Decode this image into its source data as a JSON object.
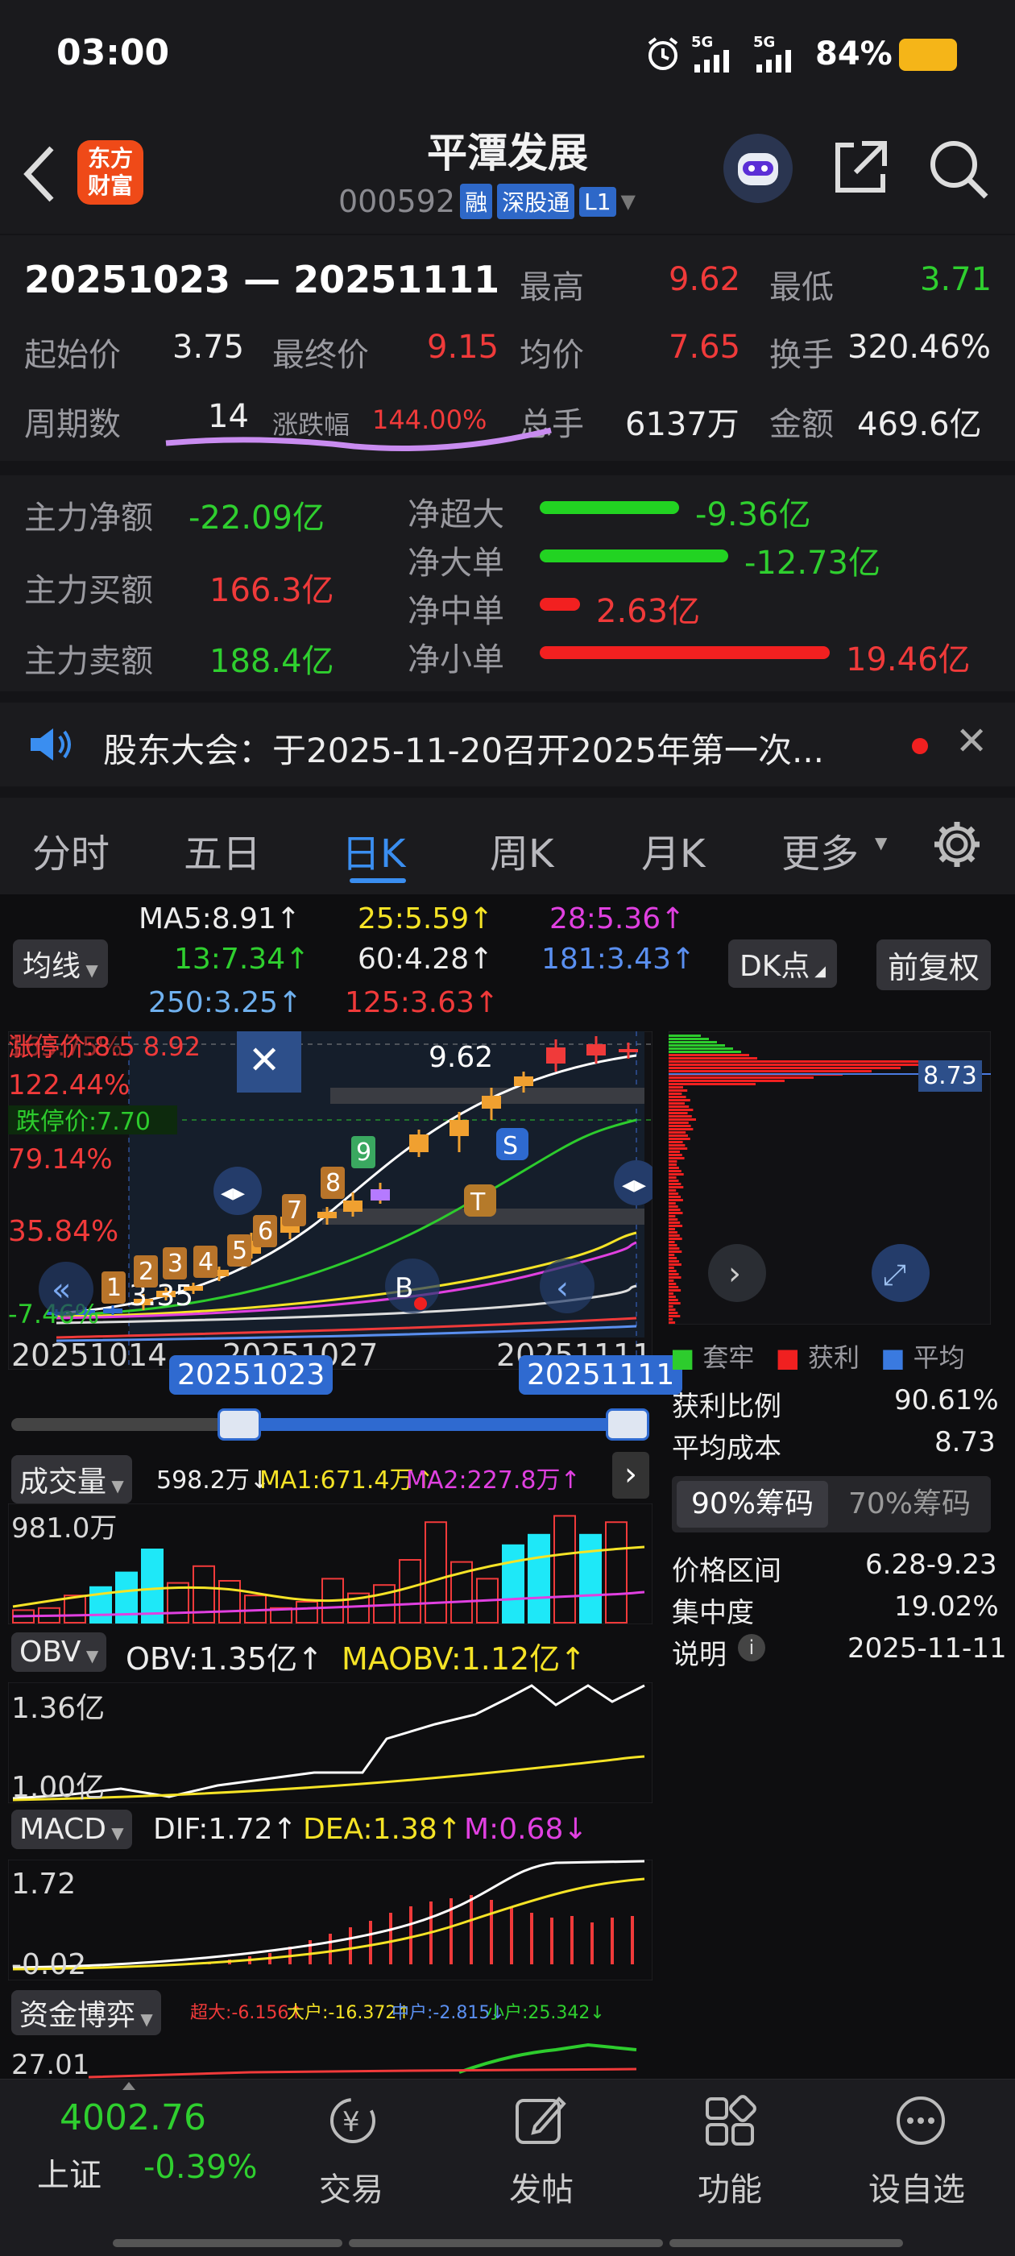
{
  "status_bar": {
    "time": "03:00",
    "signal1": "5G",
    "signal2": "5G",
    "battery": "84%"
  },
  "header": {
    "brand_line1": "东方",
    "brand_line2": "财富",
    "title": "平潭发展",
    "code": "000592",
    "badge_margin": "融",
    "badge_connect": "深股通",
    "badge_level": "L1"
  },
  "range": {
    "dates": "20251023 — 20251111",
    "high_label": "最高",
    "high": "9.62",
    "low_label": "最低",
    "low": "3.71",
    "start_label": "起始价",
    "start": "3.75",
    "end_label": "最终价",
    "end": "9.15",
    "avg_label": "均价",
    "avg": "7.65",
    "turnover_label": "换手",
    "turnover": "320.46%",
    "periods_label": "周期数",
    "periods": "14",
    "change_label": "涨跌幅",
    "change": "144.00%",
    "volume_label": "总手",
    "volume": "6137万",
    "amount_label": "金额",
    "amount": "469.6亿"
  },
  "fund_flow": {
    "net_label": "主力净额",
    "net": "-22.09亿",
    "buy_label": "主力买额",
    "buy": "166.3亿",
    "sell_label": "主力卖额",
    "sell": "188.4亿",
    "bars": [
      {
        "label": "净超大",
        "value": "-9.36亿",
        "color": "#22d322",
        "ratio": 0.48
      },
      {
        "label": "净大单",
        "value": "-12.73亿",
        "color": "#22d322",
        "ratio": 0.65
      },
      {
        "label": "净中单",
        "value": "2.63亿",
        "color": "#f22020",
        "ratio": 0.14
      },
      {
        "label": "净小单",
        "value": "19.46亿",
        "color": "#f22020",
        "ratio": 1.0
      }
    ]
  },
  "notice": {
    "text": "股东大会：于2025-11-20召开2025年第一次..."
  },
  "tabs": [
    "分时",
    "五日",
    "日K",
    "周K",
    "月K",
    "更多"
  ],
  "active_tab": "日K",
  "ma_legend": {
    "ma5": "MA5:8.91↑",
    "ma25": "25:5.59↑",
    "ma28": "28:5.36↑",
    "ma13": "13:7.34↑",
    "ma60": "60:4.28↑",
    "ma181": "181:3.43↑",
    "ma250": "250:3.25↑",
    "ma125": "125:3.63↑",
    "junxian": "均线",
    "dk": "DK点",
    "fq": "前复权"
  },
  "kchart": {
    "limit_label": "涨停价:8.5 8.92",
    "pct1": "165.75%",
    "pct2": "122.44%",
    "limit_down": "跌停价:7.70",
    "pct3": "79.14%",
    "pct4": "35.84%",
    "pct5": "-7.46%",
    "high_marker": "9.62",
    "low_marker": "3.35",
    "date_left": "20251014",
    "date_mid": "20251027",
    "date_right": "20251111",
    "sel_start": "20251023",
    "sel_end": "20251111"
  },
  "chip": {
    "avg_tag": "8.73",
    "legend_trap": "套牢",
    "legend_profit": "获利",
    "legend_avg": "平均",
    "profit_ratio_label": "获利比例",
    "profit_ratio": "90.61%",
    "avg_cost_label": "平均成本",
    "avg_cost": "8.73",
    "tab90": "90%筹码",
    "tab70": "70%筹码",
    "range_label": "价格区间",
    "range": "6.28-9.23",
    "conc_label": "集中度",
    "conc": "19.02%",
    "note_label": "说明",
    "note": "2025-11-11"
  },
  "volume_panel": {
    "title": "成交量",
    "v": "598.2万↓",
    "ma1": "MA1:671.4万↑",
    "ma2": "MA2:227.8万↑",
    "max": "981.0万"
  },
  "obv_panel": {
    "title": "OBV",
    "obv": "OBV:1.35亿↑",
    "maobv": "MAOBV:1.12亿↑",
    "top": "1.36亿",
    "bottom": "1.00亿"
  },
  "macd_panel": {
    "title": "MACD",
    "dif": "DIF:1.72↑",
    "dea": "DEA:1.38↑",
    "m": "M:0.68↓",
    "top": "1.72",
    "bottom": "-0.02"
  },
  "fund_panel": {
    "title": "资金博弈",
    "super": "超大:-6.156↑",
    "big": "大户:-16.372↑",
    "mid": "中户:-2.815↓",
    "small": "小户:25.342↓",
    "top": "27.01"
  },
  "bottom_bar": {
    "index_value": "4002.76",
    "index_name": "上证",
    "index_change": "-0.39%",
    "trade": "交易",
    "post": "发帖",
    "func": "功能",
    "watch": "设自选"
  },
  "chart_data": {
    "type": "candlestick",
    "x": [
      "1",
      "2",
      "3",
      "4",
      "5",
      "6",
      "7",
      "8",
      "9",
      "10",
      "11",
      "12",
      "13",
      "14"
    ],
    "markers": [
      "1",
      "2",
      "3",
      "4",
      "5",
      "6",
      "7",
      "8",
      "9"
    ],
    "high": 9.62,
    "low": 3.35
  }
}
